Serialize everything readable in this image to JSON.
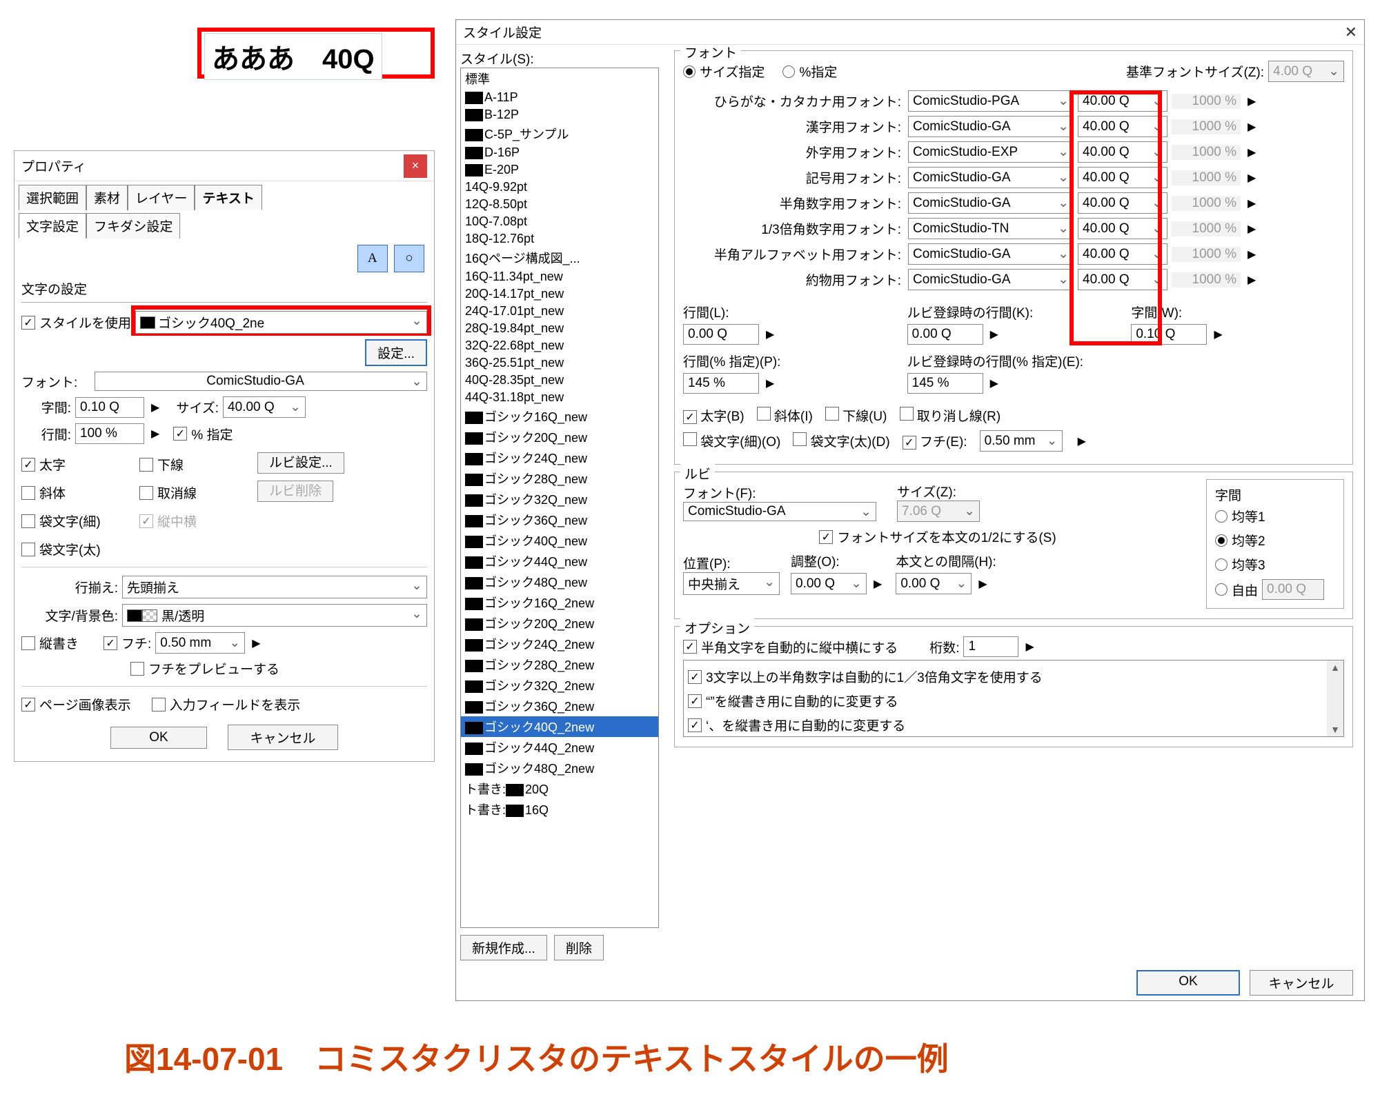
{
  "preview": {
    "text": "あああ　40Q"
  },
  "caption": "図14-07-01　コミスタクリスタのテキストスタイルの一例",
  "property": {
    "title": "プロパティ",
    "tabs1": [
      "選択範囲",
      "素材",
      "レイヤー",
      "テキスト"
    ],
    "tabs1_active": 3,
    "tabs2": [
      "文字設定",
      "フキダシ設定"
    ],
    "tabs2_active": 0,
    "section": "文字の設定",
    "use_style": "スタイルを使用",
    "style_value": "ゴシック40Q_2ne",
    "settings_btn": "設定...",
    "font_label": "フォント:",
    "font_value": "ComicStudio-GA",
    "labels": {
      "jikan": "字間:",
      "size": "サイズ:",
      "gyokan": "行間:",
      "pct_spec": "% 指定",
      "bold": "太字",
      "kasen": "下線",
      "ruby_set": "ルビ設定...",
      "shatai": "斜体",
      "torikeshi": "取消線",
      "ruby_del": "ルビ削除",
      "fukuro_hoso": "袋文字(細)",
      "tatechuyoko": "縦中横",
      "fukuro_futo": "袋文字(太)",
      "gyozoroe": "行揃え:",
      "gyozoroe_val": "先頭揃え",
      "text_bg": "文字/背景色:",
      "text_bg_val": "黒/透明",
      "tategaki": "縦書き",
      "fuchi": "フチ:",
      "fuchi_val": "0.50 mm",
      "fuchi_preview": "フチをプレビューする",
      "page_img": "ページ画像表示",
      "input_field": "入力フィールドを表示",
      "ok": "OK",
      "cancel": "キャンセル"
    },
    "values": {
      "jikan": "0.10 Q",
      "size": "40.00 Q",
      "gyokan": "100 %"
    }
  },
  "style_dlg": {
    "title": "スタイル設定",
    "styles_label": "スタイル(S):",
    "list": [
      {
        "t": "標準"
      },
      {
        "b": 1,
        "t": "A-11P"
      },
      {
        "b": 1,
        "t": "B-12P"
      },
      {
        "b": 1,
        "t": "C-5P_サンプル"
      },
      {
        "b": 1,
        "t": "D-16P"
      },
      {
        "b": 1,
        "t": "E-20P"
      },
      {
        "t": "14Q-9.92pt"
      },
      {
        "t": "12Q-8.50pt"
      },
      {
        "t": "10Q-7.08pt"
      },
      {
        "t": "18Q-12.76pt"
      },
      {
        "t": "16Qページ構成図_..."
      },
      {
        "t": "16Q-11.34pt_new"
      },
      {
        "t": "20Q-14.17pt_new"
      },
      {
        "t": "24Q-17.01pt_new"
      },
      {
        "t": "28Q-19.84pt_new"
      },
      {
        "t": "32Q-22.68pt_new"
      },
      {
        "t": "36Q-25.51pt_new"
      },
      {
        "t": "40Q-28.35pt_new"
      },
      {
        "t": "44Q-31.18pt_new"
      },
      {
        "b": 1,
        "t": "ゴシック16Q_new"
      },
      {
        "b": 1,
        "t": "ゴシック20Q_new"
      },
      {
        "b": 1,
        "t": "ゴシック24Q_new"
      },
      {
        "b": 1,
        "t": "ゴシック28Q_new"
      },
      {
        "b": 1,
        "t": "ゴシック32Q_new"
      },
      {
        "b": 1,
        "t": "ゴシック36Q_new"
      },
      {
        "b": 1,
        "t": "ゴシック40Q_new"
      },
      {
        "b": 1,
        "t": "ゴシック44Q_new"
      },
      {
        "b": 1,
        "t": "ゴシック48Q_new"
      },
      {
        "b": 1,
        "t": "ゴシック16Q_2new"
      },
      {
        "b": 1,
        "t": "ゴシック20Q_2new"
      },
      {
        "b": 1,
        "t": "ゴシック24Q_2new"
      },
      {
        "b": 1,
        "t": "ゴシック28Q_2new"
      },
      {
        "b": 1,
        "t": "ゴシック32Q_2new"
      },
      {
        "b": 1,
        "t": "ゴシック36Q_2new"
      },
      {
        "b": 1,
        "t": "ゴシック40Q_2new",
        "sel": 1
      },
      {
        "b": 1,
        "t": "ゴシック44Q_2new"
      },
      {
        "b": 1,
        "t": "ゴシック48Q_2new"
      },
      {
        "p": "ト書き:",
        "b": 1,
        "t": "20Q"
      },
      {
        "p": "ト書き:",
        "b": 1,
        "t": "16Q"
      }
    ],
    "new_btn": "新規作成...",
    "delete_btn": "削除",
    "font_group": "フォント",
    "size_spec": "サイズ指定",
    "pct_spec": "%指定",
    "base_size_label": "基準フォントサイズ(Z):",
    "base_size": "4.00 Q",
    "font_rows": [
      {
        "label": "ひらがな・カタカナ用フォント:",
        "font": "ComicStudio-PGA",
        "size": "40.00 Q",
        "pct": "1000 %"
      },
      {
        "label": "漢字用フォント:",
        "font": "ComicStudio-GA",
        "size": "40.00 Q",
        "pct": "1000 %"
      },
      {
        "label": "外字用フォント:",
        "font": "ComicStudio-EXP",
        "size": "40.00 Q",
        "pct": "1000 %"
      },
      {
        "label": "記号用フォント:",
        "font": "ComicStudio-GA",
        "size": "40.00 Q",
        "pct": "1000 %"
      },
      {
        "label": "半角数字用フォント:",
        "font": "ComicStudio-GA",
        "size": "40.00 Q",
        "pct": "1000 %"
      },
      {
        "label": "1/3倍角数字用フォント:",
        "font": "ComicStudio-TN",
        "size": "40.00 Q",
        "pct": "1000 %"
      },
      {
        "label": "半角アルファベット用フォント:",
        "font": "ComicStudio-GA",
        "size": "40.00 Q",
        "pct": "1000 %"
      },
      {
        "label": "約物用フォント:",
        "font": "ComicStudio-GA",
        "size": "40.00 Q",
        "pct": "1000 %"
      }
    ],
    "spacing": {
      "gyokan": "行間(L):",
      "gyokan_v": "0.00 Q",
      "ruby_gyokan": "ルビ登録時の行間(K):",
      "ruby_gyokan_v": "0.00 Q",
      "jikan": "字間(W):",
      "jikan_v": "0.10 Q",
      "gyokan_pct": "行間(% 指定)(P):",
      "gyokan_pct_v": "145 %",
      "ruby_gyokan_pct": "ルビ登録時の行間(% 指定)(E):",
      "ruby_gyokan_pct_v": "145 %"
    },
    "checks": {
      "futoji": "太字(B)",
      "shatai": "斜体(I)",
      "kasen": "下線(U)",
      "torikeshi": "取り消し線(R)",
      "fukuro_hoso": "袋文字(細)(O)",
      "fukuro_futo": "袋文字(太)(D)",
      "fuchi": "フチ(E):",
      "fuchi_v": "0.50 mm"
    },
    "ruby": {
      "group": "ルビ",
      "font_l": "フォント(F):",
      "font_v": "ComicStudio-GA",
      "size_l": "サイズ(Z):",
      "size_v": "7.06 Q",
      "half": "フォントサイズを本文の1/2にする(S)",
      "pos_l": "位置(P):",
      "pos_v": "中央揃え",
      "adj_l": "調整(O):",
      "adj_v": "0.00 Q",
      "gap_l": "本文との間隔(H):",
      "gap_v": "0.00 Q",
      "jikan_l": "字間",
      "opt1": "均等1",
      "opt2": "均等2",
      "opt3": "均等3",
      "opt4": "自由",
      "opt4_v": "0.00 Q"
    },
    "options": {
      "group": "オプション",
      "tatechuyoko": "半角文字を自動的に縦中横にする",
      "keta_l": "桁数:",
      "keta_v": "1",
      "o1": "3文字以上の半角数字は自動的に1／3倍角文字を使用する",
      "o2": "“”を縦書き用に自動的に変更する",
      "o3": "‘、を縦書き用に自動的に変更する"
    },
    "ok": "OK",
    "cancel": "キャンセル"
  }
}
